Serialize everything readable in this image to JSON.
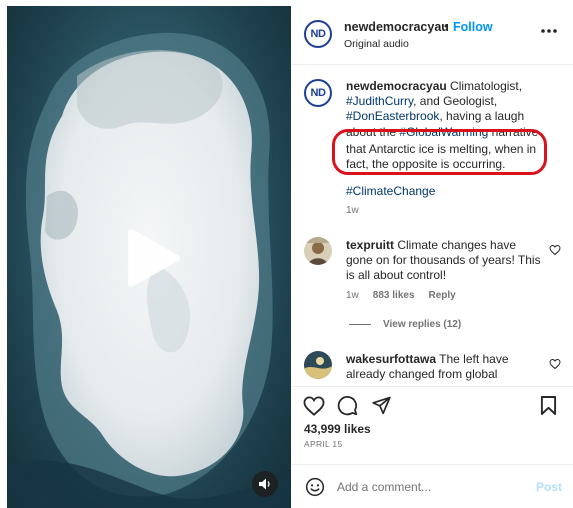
{
  "header": {
    "avatar_initials": "ND",
    "username": "newdemocracyau",
    "separator": "•",
    "follow_label": "Follow",
    "subtitle": "Original audio"
  },
  "caption": {
    "username": "newdemocracyau",
    "text_1": " Climatologist, ",
    "mention_1": "#JudithCurry",
    "text_2": ", and Geologist, ",
    "mention_2": "#DonEasterbrook",
    "text_3": ", having a laugh ",
    "text_4": "about the ",
    "hashtag_strike": "#GlobalWarming",
    "text_5": " narrative",
    "highlighted_text": "that Antarctic ice is melting, when in fact, the opposite is occurring.",
    "hashtag": "#ClimateChange",
    "time": "1w"
  },
  "comments": [
    {
      "username": "texpruitt",
      "text": " Climate changes have gone on for thousands of years! This is all about control!",
      "time": "1w",
      "likes": "883 likes",
      "reply_label": "Reply",
      "view_replies": "View replies (12)"
    },
    {
      "username": "wakesurfottawa",
      "text": " The left have already changed from global"
    }
  ],
  "actions": {
    "likes": "43,999 likes",
    "date": "APRIL 15"
  },
  "add_comment": {
    "placeholder": "Add a comment...",
    "post_label": "Post"
  },
  "colors": {
    "link_blue": "#0095f6",
    "hashtag_blue": "#00376b",
    "annotation_red": "#d9121b",
    "brand_navy": "#1b3f95"
  }
}
